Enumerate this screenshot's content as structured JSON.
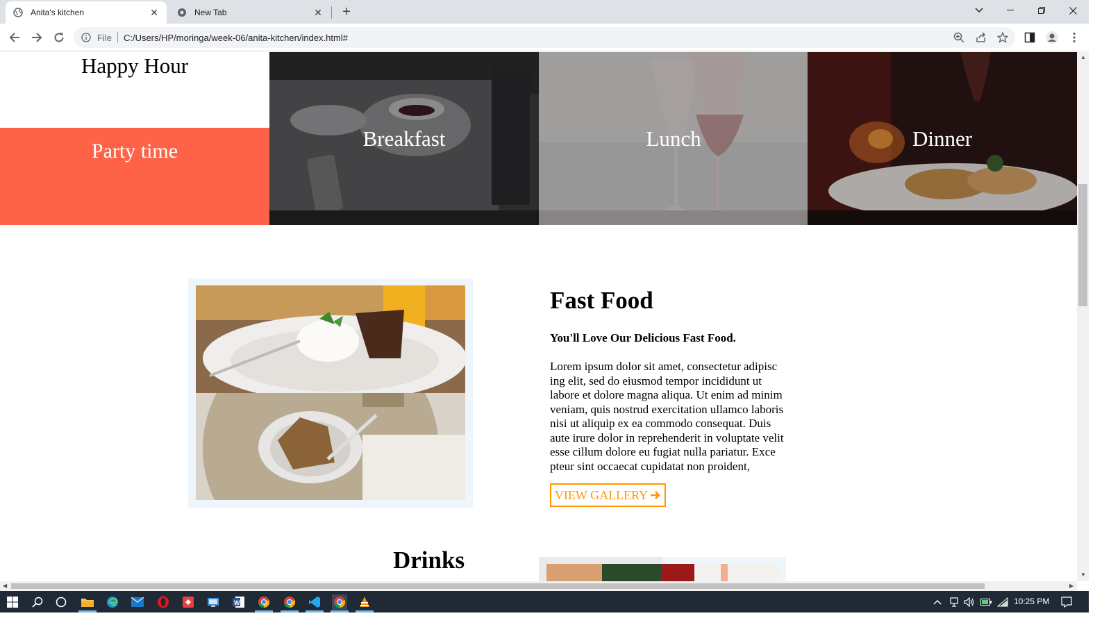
{
  "browser": {
    "tabs": [
      {
        "title": "Anita's kitchen",
        "active": true
      },
      {
        "title": "New Tab",
        "active": false
      }
    ],
    "address_scheme": "File",
    "address_url": "C:/Users/HP/moringa/week-06/anita-kitchen/index.html#"
  },
  "page": {
    "happy_hour": "Happy Hour",
    "party_time": "Party time",
    "meals": [
      "Breakfast",
      "Lunch",
      "Dinner"
    ],
    "fast_food": {
      "title": "Fast Food",
      "subtitle": "You'll Love Our Delicious Fast Food.",
      "body_lines": [
        "Lorem ipsum dolor sit amet, consectetur adipisc",
        "ing elit, sed do eiusmod tempor incididunt ut",
        "labore et dolore magna aliqua. Ut enim ad minim",
        "veniam, quis nostrud exercitation ullamco laboris",
        "nisi ut aliquip ex ea commodo consequat. Duis",
        "aute irure dolor in reprehenderit in voluptate velit",
        "esse cillum dolore eu fugiat nulla pariatur. Exce",
        "pteur sint occaecat cupidatat non proident,"
      ],
      "button_label": "VIEW GALLERY",
      "button_icon": "arrow-right-icon"
    },
    "drinks_title": "Drinks"
  },
  "colors": {
    "party_bg": "#ff6347",
    "button_accent": "#ff9800",
    "frame_bg": "#eef6fc"
  },
  "taskbar": {
    "clock": "10:25 PM"
  }
}
